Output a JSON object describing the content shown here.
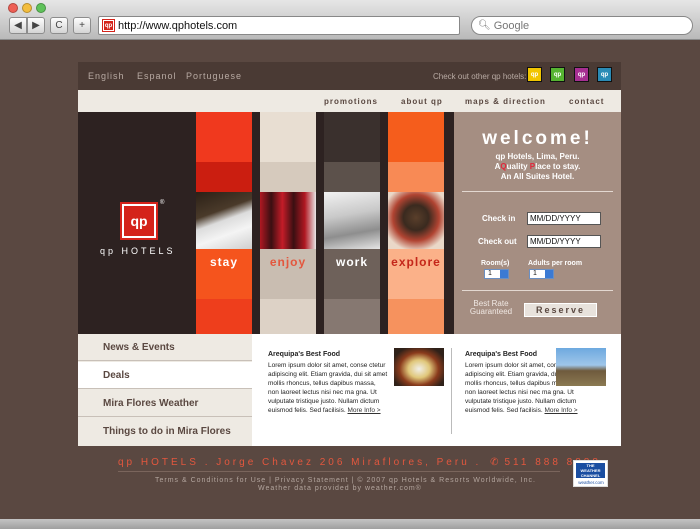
{
  "browser": {
    "url": "http://www.qphotels.com",
    "search_placeholder": "Google",
    "back_label": "◀",
    "forward_label": "▶",
    "reload_label": "C",
    "add_label": "+",
    "favicon_text": "qp"
  },
  "languages": [
    "English",
    "Espanol",
    "Portuguese"
  ],
  "other_hotels_text": "Check out other qp hotels:",
  "other_hotels": [
    {
      "label": "qp",
      "color": "#f2c500"
    },
    {
      "label": "qp",
      "color": "#56b431"
    },
    {
      "label": "qp",
      "color": "#a62f91"
    },
    {
      "label": "qp",
      "color": "#2a8bb6"
    }
  ],
  "menu": [
    "promotions",
    "about qp",
    "maps & direction",
    "contact"
  ],
  "brand": {
    "logo": "qp",
    "registered": "®",
    "name": "qp HOTELS"
  },
  "hero_strips": [
    "stay",
    "enjoy",
    "work",
    "explore"
  ],
  "booking": {
    "welcome": "welcome!",
    "line1": "qp Hotels, Lima, Peru.",
    "line2_pre": "A",
    "line2_q": "Q",
    "line2_mid": "uality ",
    "line2_p": "P",
    "line2_post": "lace to stay.",
    "line3": "An All Suites Hotel.",
    "checkin_label": "Check in",
    "checkin_value": "MM/DD/YYYY",
    "checkout_label": "Check out",
    "checkout_value": "MM/DD/YYYY",
    "rooms_label": "Room(s)",
    "rooms_value": "1",
    "adults_label": "Adults per room",
    "adults_value": "1",
    "best_rate": "Best Rate Guaranteed",
    "reserve": "Reserve"
  },
  "left_nav": [
    "News & Events",
    "Deals",
    "Mira Flores Weather",
    "Things to do in Mira Flores"
  ],
  "articles": [
    {
      "title": "Arequipa's Best Food",
      "text": "Lorem ipsum dolor sit amet, conse ctetur adipiscing elit. Etiam gravida, dui sit amet mollis rhoncus, tellus dapibus massa, non laoreet lectus nisi nec ma gna. Ut vulputate tristique justo. Nullam dictum euismod felis. Sed facilisis.",
      "more": "More Info >"
    },
    {
      "title": "Arequipa's Best Food",
      "text": "Lorem ipsum dolor sit amet, consectetur adipiscing elit. Etiam gravida, dui sit amet mollis rhoncus, tellus dapibus massa, non laoreet lectus nisi nec ma gna. Ut vulputate tristique justo. Nullam dictum euismod felis. Sed facilisis.",
      "more": "More Info >"
    }
  ],
  "footer": {
    "address": "qp HOTELS  .  Jorge Chavez 206 Miraflores, Peru  .",
    "phone_icon": "✆",
    "phone": "511 888 8888",
    "links": "Terms & Conditions for Use | Privacy Statement | © 2007 qp Hotels & Resorts Worldwide, Inc.",
    "weather_credit": "Weather data provided by weather.com®",
    "weather_badge_top": "THE WEATHER CHANNEL",
    "weather_badge_bottom": "weather.com"
  },
  "colors": {
    "background": "#5a4841",
    "accent": "#e3573e",
    "brand_red": "#d4231a"
  }
}
